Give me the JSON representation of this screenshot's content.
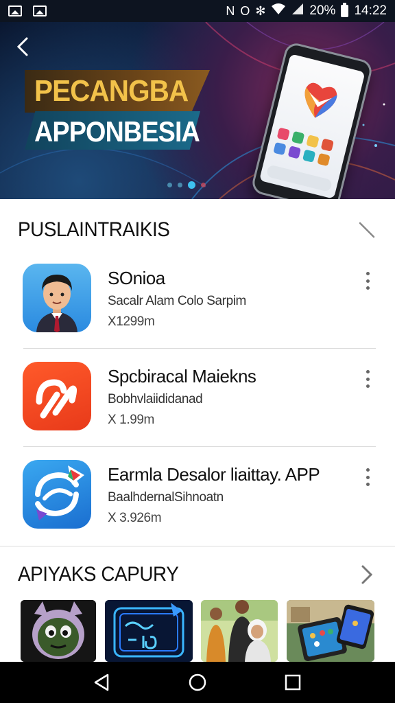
{
  "status_bar": {
    "battery": "20%",
    "time": "14:22",
    "icons": [
      "image-icon",
      "gallery-icon",
      "nfc-icon",
      "alarm-icon",
      "bluetooth-icon",
      "wifi-icon",
      "signal-icon",
      "battery-icon"
    ],
    "nfc_glyph": "N",
    "alarm_glyph": "O",
    "bluetooth_glyph": "✻"
  },
  "banner": {
    "title_line1": "PECANGBA",
    "title_line2": "APPONBESIA",
    "pagination": {
      "count": 4,
      "active_index": 2
    }
  },
  "section1": {
    "title": "PUSLAINTRAIKIS",
    "apps": [
      {
        "name": "SOnioa",
        "subtitle": "Sacalr Alam Colo Sarpim",
        "size": "X1299m",
        "icon": "avatar-man-icon"
      },
      {
        "name": "Spcbiracal Maiekns",
        "subtitle": "Bobhvlaiididanad",
        "size": "X 1.99m",
        "icon": "red-link-logo-icon"
      },
      {
        "name": "Earmla Desalor liaittay. APP",
        "subtitle": "BaalhdernalSihnoatn",
        "size": "X 3.926m",
        "icon": "sync-arrows-icon"
      }
    ]
  },
  "section2": {
    "title": "APIYAKS CAPURY",
    "thumbnails": [
      "alien-cat-character",
      "neon-sign-artwork",
      "people-photo",
      "phones-collage"
    ]
  },
  "colors": {
    "banner_bg": "#0a1730",
    "accent_gold": "#f2c24a",
    "accent_teal": "#1b6a8a",
    "app2_icon": "#f14a22",
    "app3_icon": "#1e8fe0",
    "nav_bg": "#000000"
  }
}
